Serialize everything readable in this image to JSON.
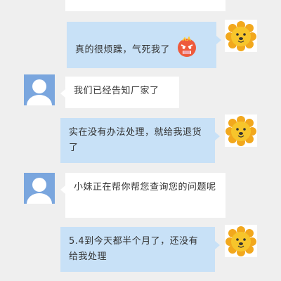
{
  "messages": [
    {
      "from": "agent",
      "text": ""
    },
    {
      "from": "user",
      "text": "真的很烦躁，气死我了",
      "emoji": "angry-face-icon"
    },
    {
      "from": "agent",
      "text": "我们已经告知厂家了"
    },
    {
      "from": "user",
      "text": "实在没有办法处理，就给我退货了"
    },
    {
      "from": "agent",
      "text": "小妹正在帮你帮您查询您的问题呢"
    },
    {
      "from": "user",
      "text": "5.4到今天都半个月了，还没有给我处理"
    }
  ],
  "avatars": {
    "user": "lion-mascot-icon",
    "agent": "default-person-icon"
  },
  "colors": {
    "background": "#efefef",
    "user_bubble": "#c8e1f7",
    "agent_bubble": "#ffffff",
    "avatar_blue": "#7aa6de",
    "lion_yellow": "#f7c52b",
    "lion_mane": "#f2a81d"
  }
}
